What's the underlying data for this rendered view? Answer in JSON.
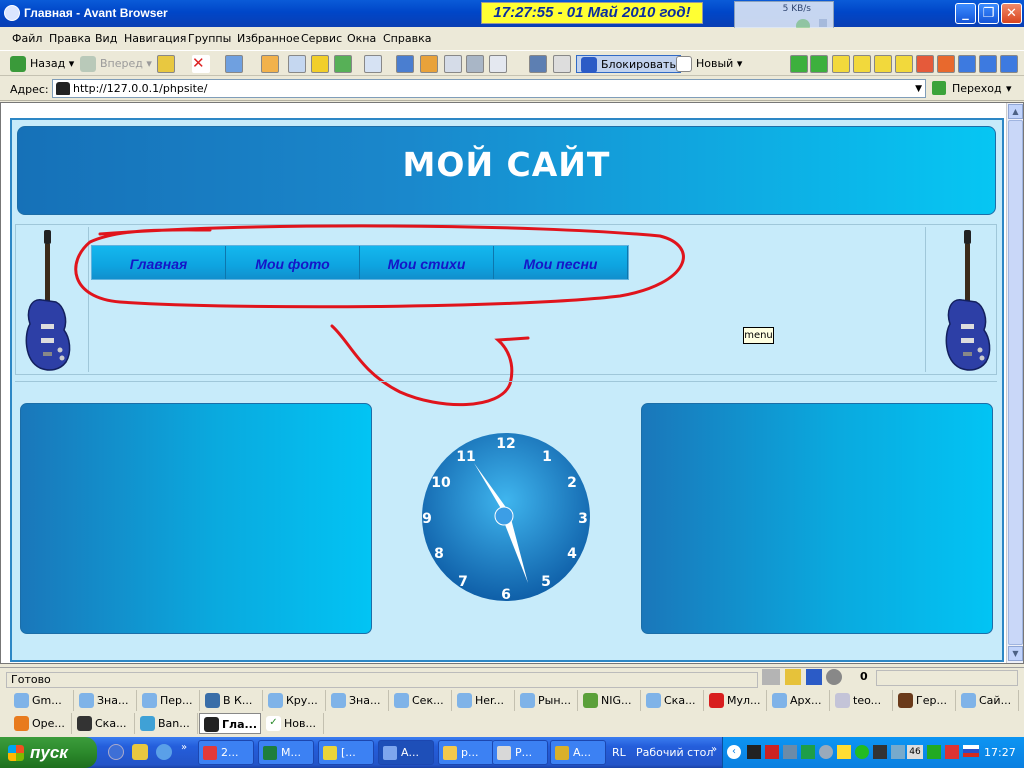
{
  "window": {
    "title": "Главная - Avant Browser",
    "clock_banner": "17:27:55  - 01 Май 2010 год!",
    "speed": "5 KB/s"
  },
  "menu": [
    "Файл",
    "Правка",
    "Вид",
    "Навигация",
    "Группы",
    "Избранное",
    "Сервис",
    "Окна",
    "Справка"
  ],
  "toolbar": {
    "back": "Назад",
    "forward": "Вперед",
    "block": "Блокировать",
    "new": "Новый"
  },
  "address": {
    "label": "Адрес:",
    "url": "http://127.0.0.1/phpsite/",
    "go": "Переход"
  },
  "site": {
    "title": "МОЙ САЙТ",
    "nav": [
      "Главная",
      "Мои фото",
      "Мои стихи",
      "Мои песни"
    ],
    "tooltip": "menu",
    "clock_numbers": [
      "12",
      "1",
      "2",
      "3",
      "4",
      "5",
      "6",
      "7",
      "8",
      "9",
      "10",
      "11"
    ]
  },
  "status": {
    "text": "Готово",
    "count": "0"
  },
  "tabs_row1": [
    "Gm...",
    "Зна...",
    "Пер...",
    "В К...",
    "Кру...",
    "Зна...",
    "Сек...",
    "Her...",
    "Рын...",
    "NIG...",
    "Ска...",
    "Мул...",
    "Арх...",
    "teo...",
    "Гер...",
    "Сай..."
  ],
  "tabs_row2": [
    "Ope...",
    "Ска...",
    "Ban...",
    "Гла...",
    "Нов..."
  ],
  "taskbar": {
    "start": "пуск",
    "tasks": [
      "2...",
      "М...",
      "[...",
      "А...",
      "p...",
      "Р...",
      "А..."
    ],
    "desktop": "Рабочий стол",
    "rl": "RL",
    "badge": "46",
    "clock": "17:27"
  },
  "colors": {
    "site_bg": "#c7ebfa",
    "header_dark": "#1671b8",
    "header_light": "#06c6f3",
    "nav_text": "#1515c8",
    "annotation": "#e0141c"
  }
}
